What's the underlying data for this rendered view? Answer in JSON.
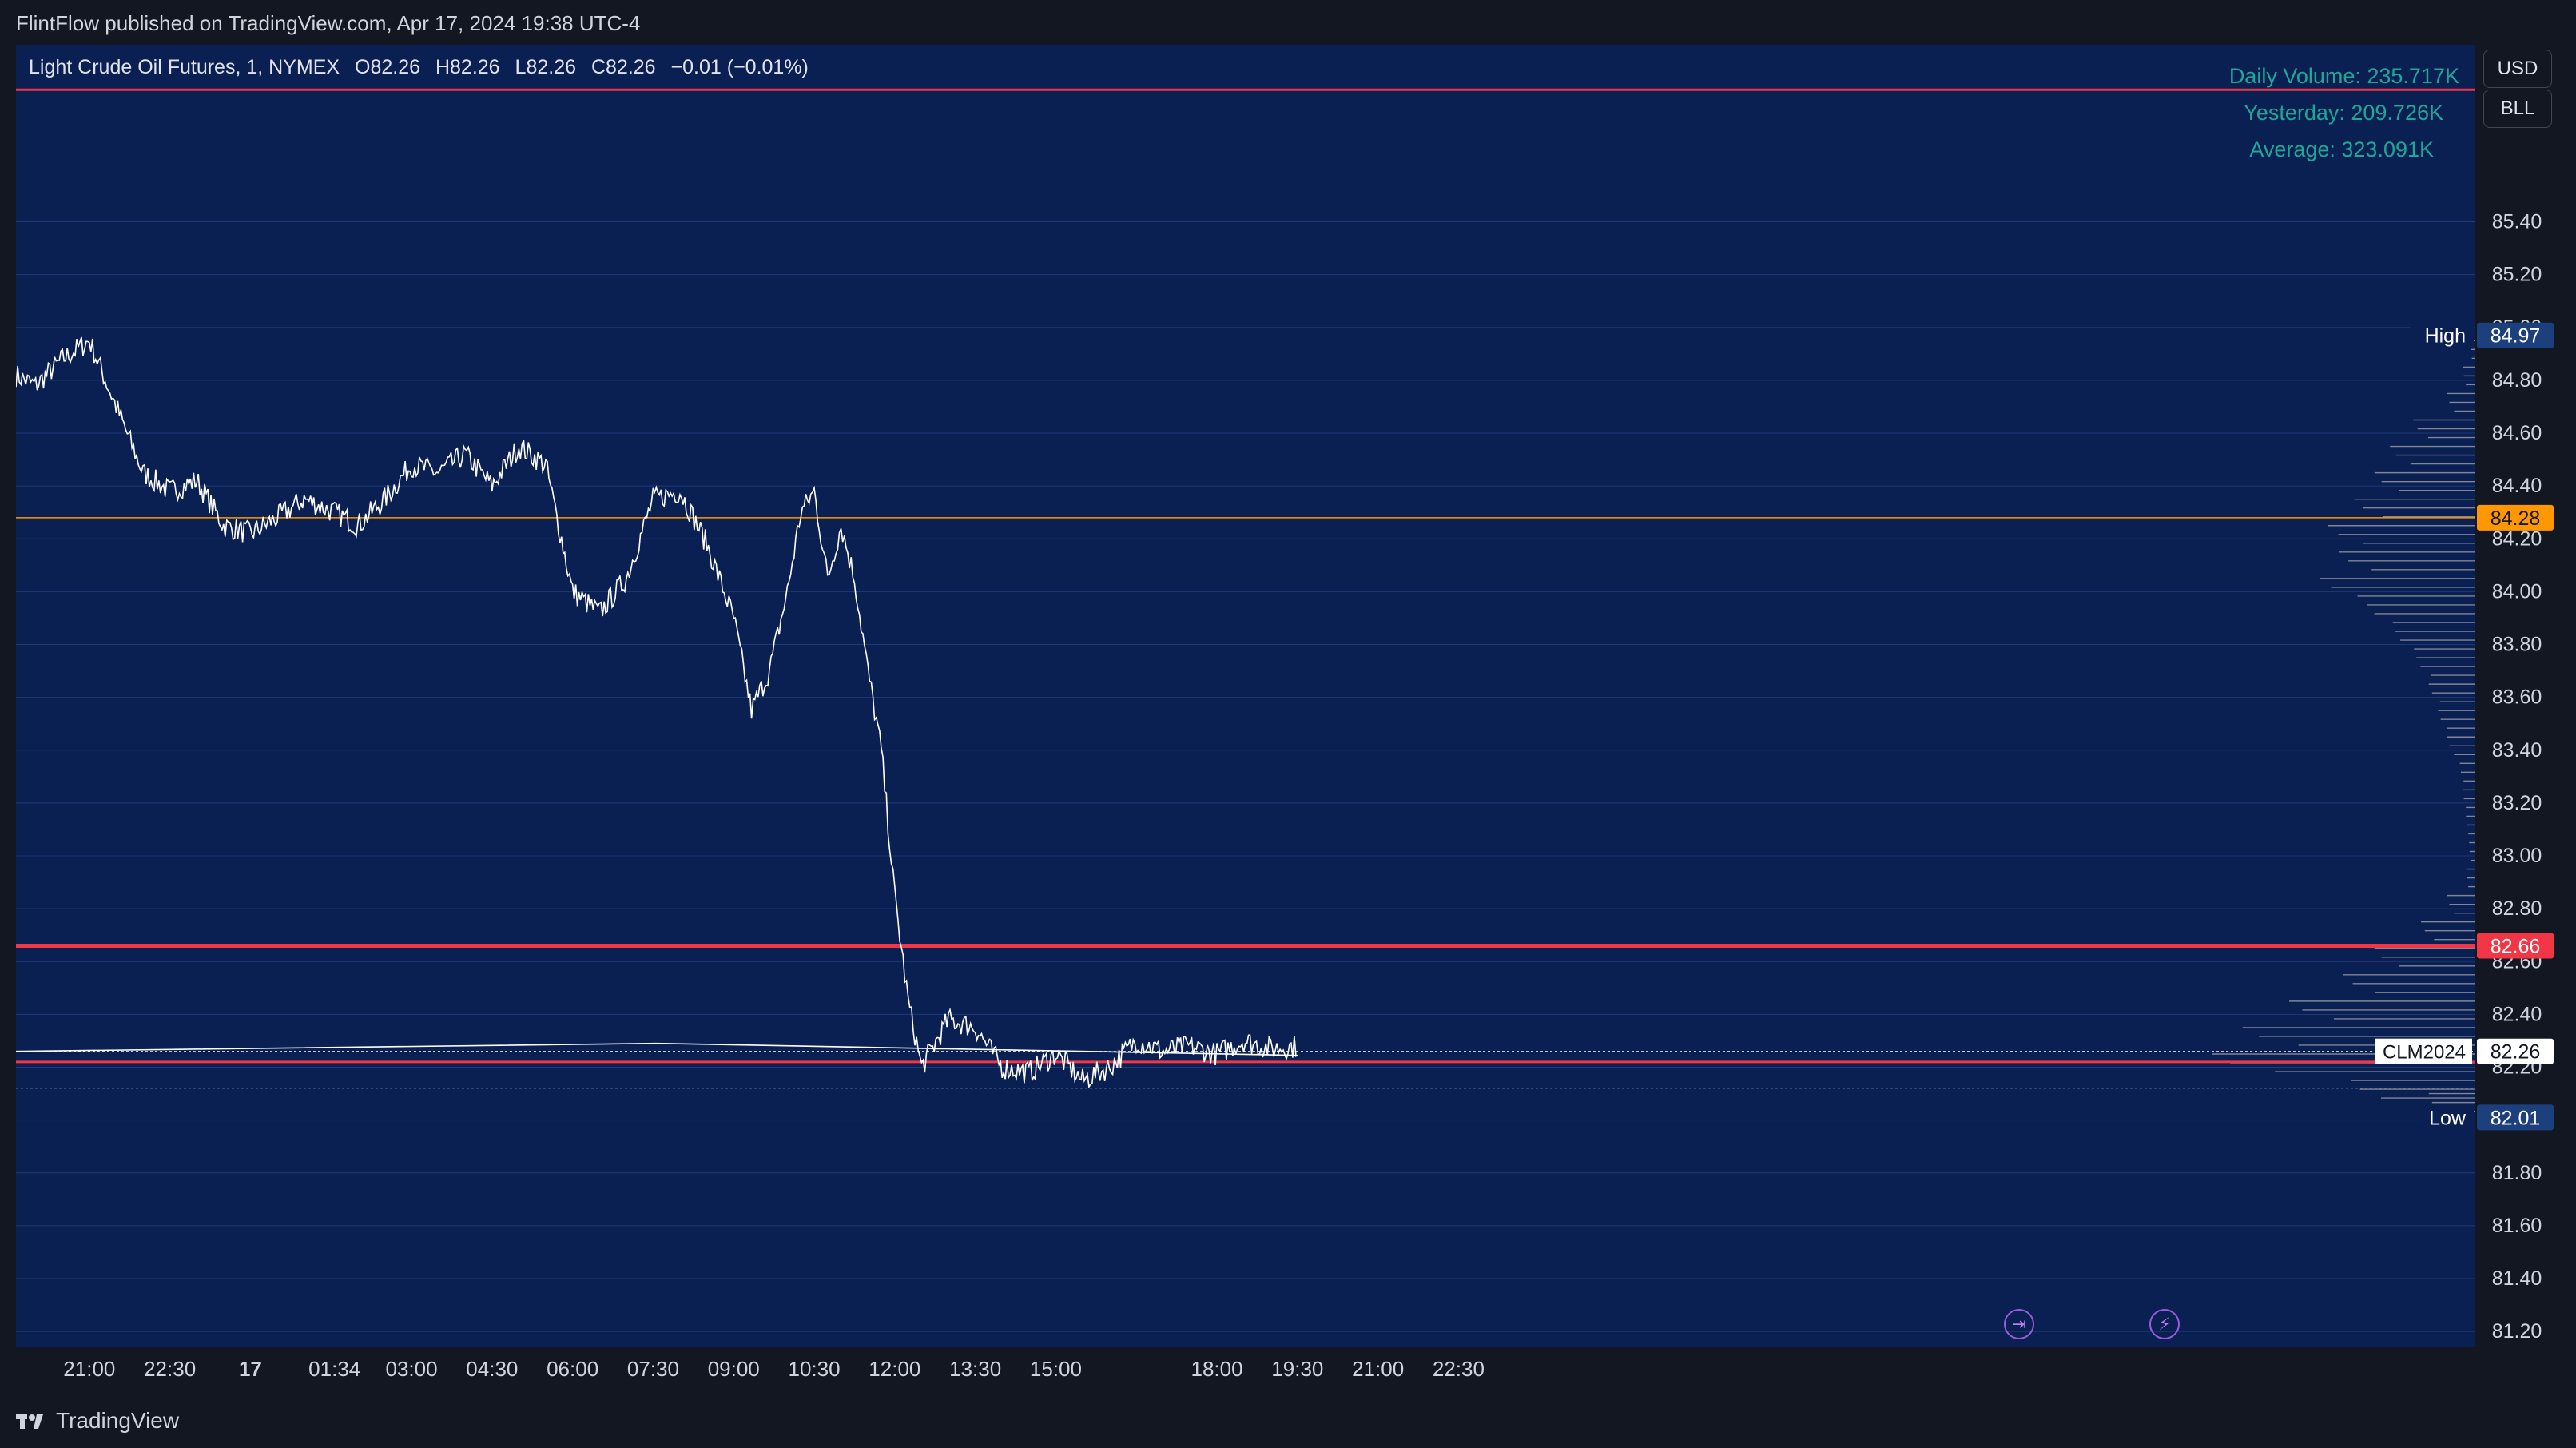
{
  "header": {
    "published": "FlintFlow published on TradingView.com, Apr 17, 2024 19:38 UTC-4"
  },
  "legend": {
    "symbol": "Light Crude Oil Futures, 1, NYMEX",
    "open": "O82.26",
    "high": "H82.26",
    "low": "L82.26",
    "close": "C82.26",
    "change": "−0.01 (−0.01%)"
  },
  "volume_info": {
    "daily": "Daily Volume: 235.717K",
    "yesterday": "Yesterday: 209.726K",
    "average": "Average: 323.091K"
  },
  "buttons": {
    "currency": "USD",
    "unit": "BLL"
  },
  "footer": {
    "brand": "TradingView"
  },
  "colors": {
    "background": "#0a1f52",
    "price_line": "#ffffff",
    "red_level": "#f23645",
    "orange_level": "#ff9800",
    "volume_text": "#1fa697",
    "profile": "#9598a1"
  },
  "chart_data": {
    "type": "line",
    "ylim": [
      81.14,
      86.07
    ],
    "y_ticks": [
      "85.40",
      "85.20",
      "85.00",
      "84.80",
      "84.60",
      "84.40",
      "84.20",
      "84.00",
      "83.80",
      "83.60",
      "83.40",
      "83.20",
      "83.00",
      "82.80",
      "82.60",
      "82.40",
      "82.20",
      "82.00",
      "81.80",
      "81.60",
      "81.40",
      "81.20"
    ],
    "x_ticks": [
      "21:00",
      "22:30",
      "17",
      "01:34",
      "03:00",
      "04:30",
      "06:00",
      "07:30",
      "09:00",
      "10:30",
      "12:00",
      "13:30",
      "15:00",
      "18:00",
      "19:30",
      "21:00",
      "22:30"
    ],
    "x": [
      "19:38",
      "20:00",
      "20:30",
      "21:00",
      "21:30",
      "22:00",
      "22:30",
      "23:00",
      "23:30",
      "00:00",
      "00:30",
      "01:00",
      "01:34",
      "02:00",
      "02:30",
      "03:00",
      "03:30",
      "04:00",
      "04:30",
      "05:00",
      "05:30",
      "06:00",
      "06:30",
      "07:00",
      "07:30",
      "08:00",
      "08:30",
      "09:00",
      "09:20",
      "09:40",
      "10:00",
      "10:15",
      "10:30",
      "10:45",
      "11:00",
      "11:15",
      "11:30",
      "11:45",
      "12:00",
      "12:15",
      "12:30",
      "13:00",
      "13:30",
      "14:00",
      "14:30",
      "15:00",
      "15:30",
      "16:00",
      "16:30",
      "17:00",
      "17:30",
      "18:00",
      "18:30",
      "19:00",
      "19:30",
      "19:38"
    ],
    "y": [
      84.82,
      84.78,
      84.88,
      84.95,
      84.7,
      84.45,
      84.38,
      84.42,
      84.25,
      84.22,
      84.28,
      84.35,
      84.3,
      84.25,
      84.35,
      84.48,
      84.45,
      84.52,
      84.4,
      84.55,
      84.48,
      84.0,
      83.92,
      84.05,
      84.35,
      84.38,
      84.18,
      83.9,
      83.55,
      83.7,
      84.0,
      84.3,
      84.38,
      84.05,
      84.25,
      84.05,
      83.7,
      83.4,
      82.85,
      82.45,
      82.2,
      82.38,
      82.35,
      82.2,
      82.18,
      82.25,
      82.15,
      82.2,
      82.3,
      82.26,
      82.28,
      82.25,
      82.3,
      82.27,
      82.28,
      82.26
    ],
    "levels": [
      {
        "price": 85.9,
        "color": "red"
      },
      {
        "price": 84.28,
        "color": "orange",
        "label": "84.28"
      },
      {
        "price": 82.66,
        "color": "red",
        "label": "82.66"
      },
      {
        "price": 82.22,
        "color": "red"
      },
      {
        "price": 82.26,
        "color": "white",
        "label": "82.26",
        "name": "CLM2024"
      }
    ],
    "markers": {
      "high": {
        "label": "High",
        "value": "84.97"
      },
      "low": {
        "label": "Low",
        "value": "82.01"
      }
    },
    "volume_profile": {
      "prices": [
        84.9,
        84.8,
        84.7,
        84.6,
        84.5,
        84.4,
        84.3,
        84.2,
        84.1,
        84.0,
        83.9,
        83.8,
        83.7,
        83.6,
        83.5,
        83.4,
        83.3,
        83.2,
        83.1,
        83.0,
        82.9,
        82.8,
        82.7,
        82.6,
        82.5,
        82.4,
        82.3,
        82.2,
        82.1,
        82.05
      ],
      "volumes": [
        3,
        8,
        18,
        40,
        55,
        65,
        78,
        95,
        88,
        100,
        70,
        52,
        38,
        30,
        24,
        18,
        10,
        8,
        6,
        4,
        6,
        18,
        35,
        65,
        85,
        120,
        150,
        170,
        80,
        30
      ]
    }
  }
}
